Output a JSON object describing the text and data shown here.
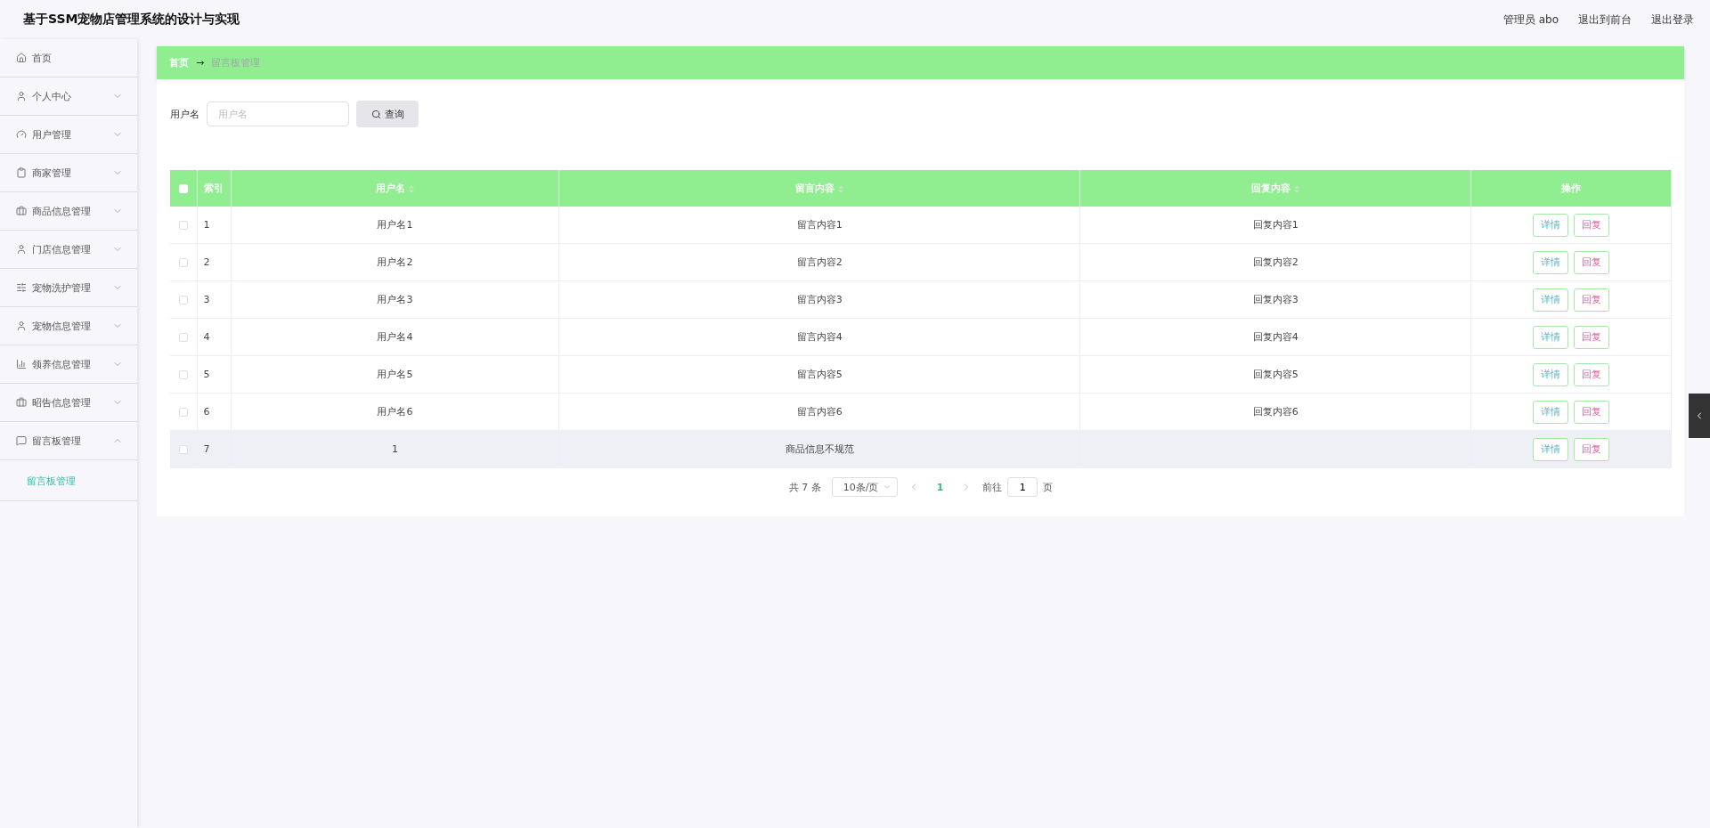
{
  "header": {
    "title": "基于SSM宠物店管理系统的设计与实现",
    "links": [
      "管理员 abo",
      "退出到前台",
      "退出登录"
    ]
  },
  "sidebar": {
    "items": [
      {
        "label": "首页",
        "kind": "link"
      },
      {
        "label": "个人中心",
        "kind": "submenu",
        "expanded": false
      },
      {
        "label": "用户管理",
        "kind": "submenu",
        "expanded": false
      },
      {
        "label": "商家管理",
        "kind": "submenu",
        "expanded": false
      },
      {
        "label": "商品信息管理",
        "kind": "submenu",
        "expanded": false
      },
      {
        "label": "门店信息管理",
        "kind": "submenu",
        "expanded": false
      },
      {
        "label": "宠物洗护管理",
        "kind": "submenu",
        "expanded": false
      },
      {
        "label": "宠物信息管理",
        "kind": "submenu",
        "expanded": false
      },
      {
        "label": "领养信息管理",
        "kind": "submenu",
        "expanded": false
      },
      {
        "label": "昭告信息管理",
        "kind": "submenu",
        "expanded": false
      },
      {
        "label": "留言板管理",
        "kind": "submenu",
        "expanded": true,
        "children": [
          {
            "label": "留言板管理",
            "selected": true
          }
        ]
      }
    ]
  },
  "breadcrumb": {
    "home": "首页",
    "separator": "→",
    "current": "留言板管理"
  },
  "search": {
    "label": "用户名",
    "placeholder": "用户名",
    "button": "查询"
  },
  "table": {
    "all_checked": false,
    "columns": [
      {
        "label": "索引",
        "sortable": false
      },
      {
        "label": "用户名",
        "sortable": true
      },
      {
        "label": "留言内容",
        "sortable": true
      },
      {
        "label": "回复内容",
        "sortable": true
      },
      {
        "label": "操作",
        "sortable": false
      }
    ],
    "rows": [
      {
        "checked": false,
        "hovered": false,
        "cells": [
          "1",
          "用户名1",
          "留言内容1",
          "回复内容1"
        ],
        "actions": [
          "详情",
          "回复"
        ]
      },
      {
        "checked": false,
        "hovered": false,
        "cells": [
          "2",
          "用户名2",
          "留言内容2",
          "回复内容2"
        ],
        "actions": [
          "详情",
          "回复"
        ]
      },
      {
        "checked": false,
        "hovered": false,
        "cells": [
          "3",
          "用户名3",
          "留言内容3",
          "回复内容3"
        ],
        "actions": [
          "详情",
          "回复"
        ]
      },
      {
        "checked": false,
        "hovered": false,
        "cells": [
          "4",
          "用户名4",
          "留言内容4",
          "回复内容4"
        ],
        "actions": [
          "详情",
          "回复"
        ]
      },
      {
        "checked": false,
        "hovered": false,
        "cells": [
          "5",
          "用户名5",
          "留言内容5",
          "回复内容5"
        ],
        "actions": [
          "详情",
          "回复"
        ]
      },
      {
        "checked": false,
        "hovered": false,
        "cells": [
          "6",
          "用户名6",
          "留言内容6",
          "回复内容6"
        ],
        "actions": [
          "详情",
          "回复"
        ]
      },
      {
        "checked": false,
        "hovered": true,
        "cells": [
          "7",
          "1",
          "商品信息不规范",
          null
        ],
        "actions": [
          "详情",
          "回复"
        ]
      }
    ]
  },
  "pagination": {
    "total": "共 7 条",
    "page_size": "10条/页",
    "pages": [
      {
        "label": "1",
        "selected": true
      }
    ],
    "goto_label": "前往",
    "goto_value": "1",
    "goto_suffix": "页"
  }
}
